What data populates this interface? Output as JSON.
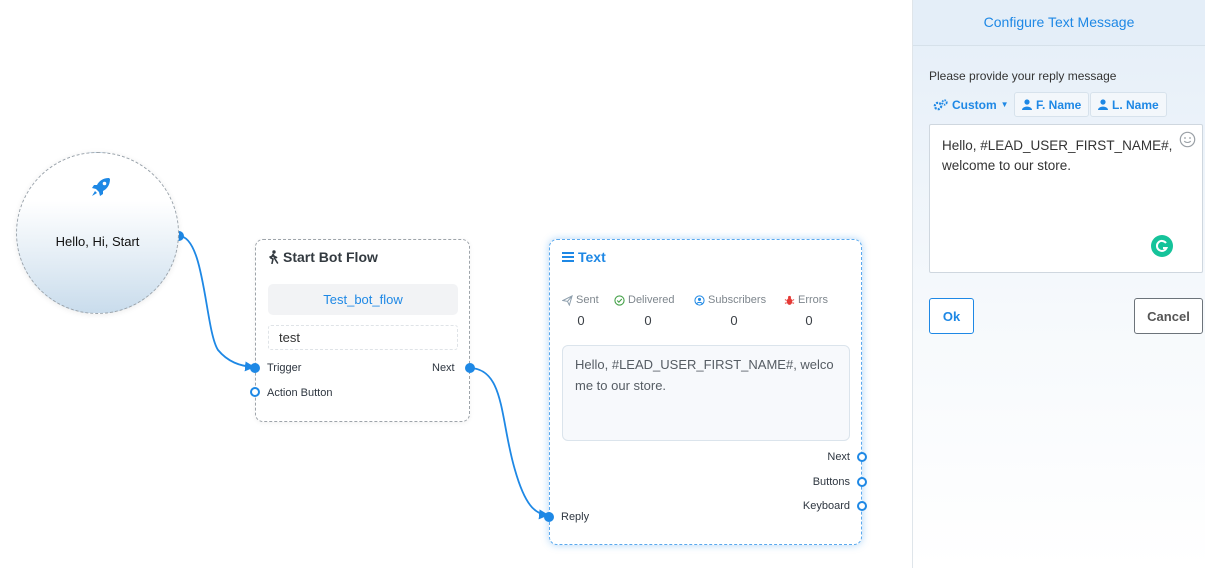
{
  "start_node": {
    "label": "Hello, Hi, Start",
    "icon": "rocket-icon"
  },
  "bot_flow_node": {
    "title": "Start Bot Flow",
    "flow_name": "Test_bot_flow",
    "input_value": "test",
    "ports": {
      "trigger": "Trigger",
      "action_button": "Action Button",
      "next": "Next"
    }
  },
  "text_node": {
    "title": "Text",
    "stats": [
      {
        "label": "Sent",
        "value": "0"
      },
      {
        "label": "Delivered",
        "value": "0"
      },
      {
        "label": "Subscribers",
        "value": "0"
      },
      {
        "label": "Errors",
        "value": "0"
      }
    ],
    "preview": "Hello, #LEAD_USER_FIRST_NAME#, welcome to our store.",
    "ports": {
      "next": "Next",
      "buttons": "Buttons",
      "keyboard": "Keyboard",
      "reply": "Reply"
    }
  },
  "panel": {
    "title": "Configure Text Message",
    "prompt": "Please provide your reply message",
    "tags": {
      "custom": "Custom",
      "first_name": "F. Name",
      "last_name": "L. Name"
    },
    "message": "Hello, #LEAD_USER_FIRST_NAME#, welcome to our store.",
    "ok_label": "Ok",
    "cancel_label": "Cancel"
  },
  "colors": {
    "accent": "#1e88e5",
    "error": "#e53935",
    "success": "#43a047",
    "grammarly": "#15c39a"
  }
}
